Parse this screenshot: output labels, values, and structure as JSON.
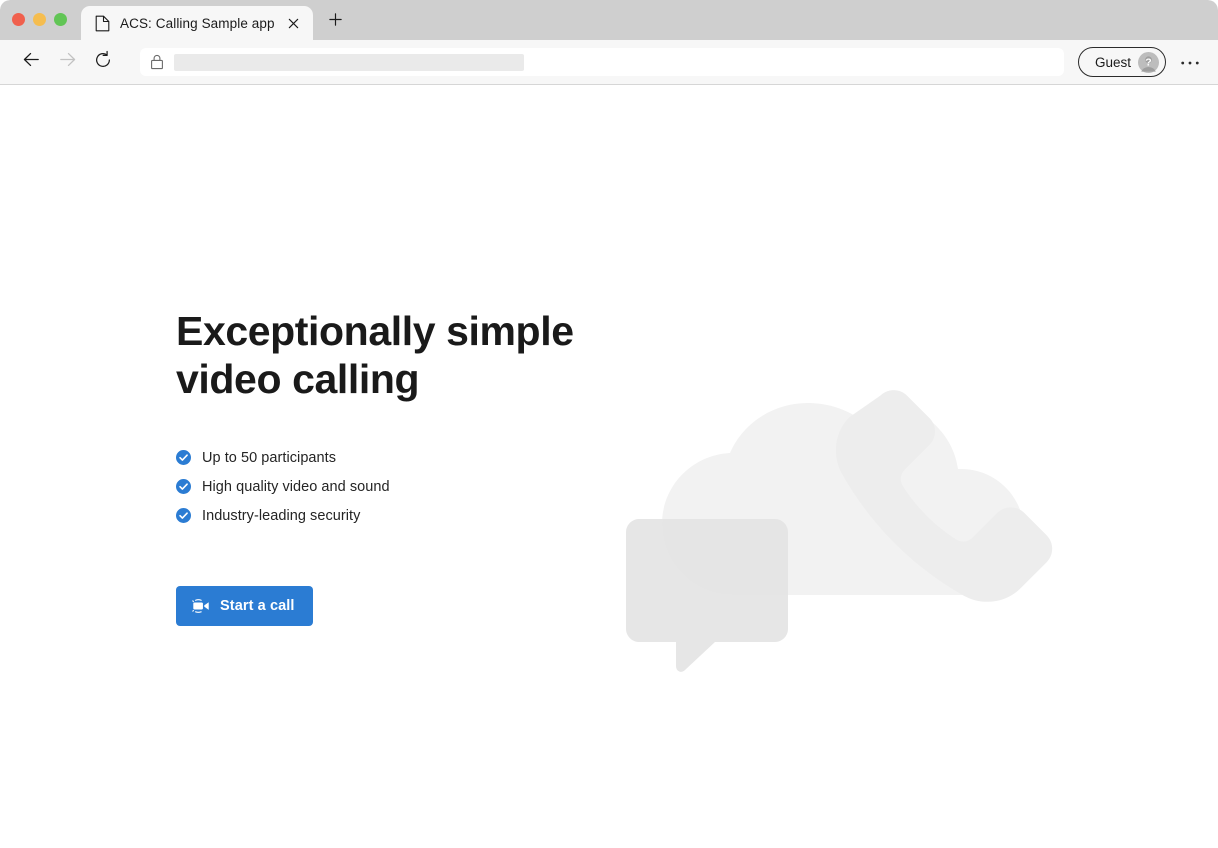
{
  "window": {
    "traffic_lights": [
      "close",
      "minimize",
      "maximize"
    ],
    "colors": {
      "close": "#f0604d",
      "minimize": "#f5bd4f",
      "maximize": "#61c555",
      "tabstrip_bg": "#cfcfcf",
      "toolbar_bg": "#f7f7f7",
      "accent_blue": "#2b7cd3",
      "page_bg": "#ffffff"
    }
  },
  "tab": {
    "title": "ACS: Calling Sample app",
    "favicon": "page-icon",
    "close_icon": "close-icon",
    "new_tab_icon": "plus-icon"
  },
  "toolbar": {
    "back_icon": "back-arrow-icon",
    "forward_icon": "forward-arrow-icon",
    "reload_icon": "reload-icon",
    "lock_icon": "lock-icon",
    "url_value": "",
    "url_placeholder": "",
    "url_redacted": true,
    "profile": {
      "label": "Guest",
      "avatar_icon": "account-question-icon"
    },
    "more_icon": "ellipsis-icon"
  },
  "main": {
    "title": "Exceptionally simple\nvideo calling",
    "features": [
      {
        "icon": "check-circle-icon",
        "label": "Up to 50 participants"
      },
      {
        "icon": "check-circle-icon",
        "label": "High quality video and sound"
      },
      {
        "icon": "check-circle-icon",
        "label": "Industry-leading security"
      }
    ],
    "start_call": {
      "label": "Start a call",
      "icon": "video-camera-icon",
      "color": "#2b7cd3"
    },
    "illustration": {
      "name": "cloud-phone-chat-illustration",
      "shapes": [
        "cloud",
        "phone-handset",
        "chat-bubble"
      ],
      "colors": {
        "cloud": "#f2f2f2",
        "phone": "#ededed",
        "chat": "#e4e4e4",
        "overlap": "#d9d9d9"
      }
    }
  }
}
